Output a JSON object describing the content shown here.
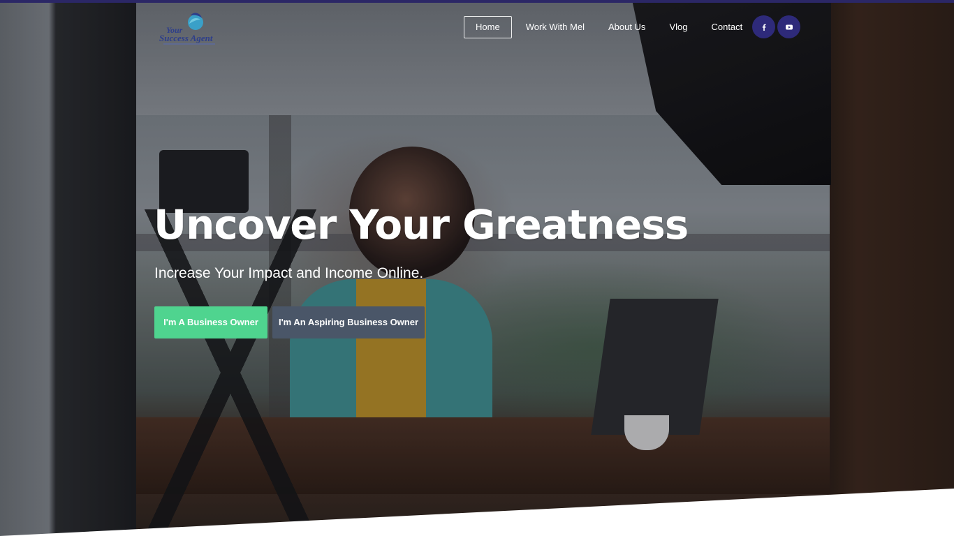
{
  "brand": {
    "logo_line_1": "Your",
    "logo_line_2": "Success Agent"
  },
  "nav": {
    "items": [
      {
        "label": "Home",
        "active": true
      },
      {
        "label": "Work With Mel",
        "active": false
      },
      {
        "label": "About Us",
        "active": false
      },
      {
        "label": "Vlog",
        "active": false
      },
      {
        "label": "Contact",
        "active": false
      }
    ]
  },
  "social": {
    "facebook_glyph": "f",
    "youtube_icon": "youtube-icon",
    "color": "#2e2a7a"
  },
  "hero": {
    "title": "Uncover Your Greatness",
    "subtitle": "Increase Your Impact and Income Online.",
    "cta_primary": "I'm A Business Owner",
    "cta_secondary": "I'm An Aspiring Business Owner"
  },
  "colors": {
    "accent_top_bar": "#2b2766",
    "cta_primary_bg": "#4fd48f",
    "cta_secondary_bg": "#4a5668",
    "brand_text": "#2d3e8a"
  }
}
